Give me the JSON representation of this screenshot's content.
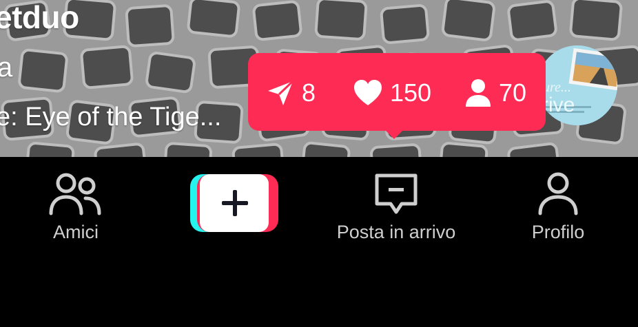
{
  "video": {
    "username": "etduo",
    "caption": "a",
    "music": "e: Eye of the Tige..."
  },
  "album": {
    "line1": "ure...",
    "line2": "rive"
  },
  "stats_tooltip": {
    "shares": "8",
    "likes": "150",
    "followers": "70",
    "accent": "#fe2c55"
  },
  "nav": {
    "friends_label": "Amici",
    "inbox_label": "Posta in arrivo",
    "profile_label": "Profilo",
    "icons": [
      "friends-icon",
      "create-plus-icon",
      "inbox-icon",
      "profile-icon"
    ]
  }
}
